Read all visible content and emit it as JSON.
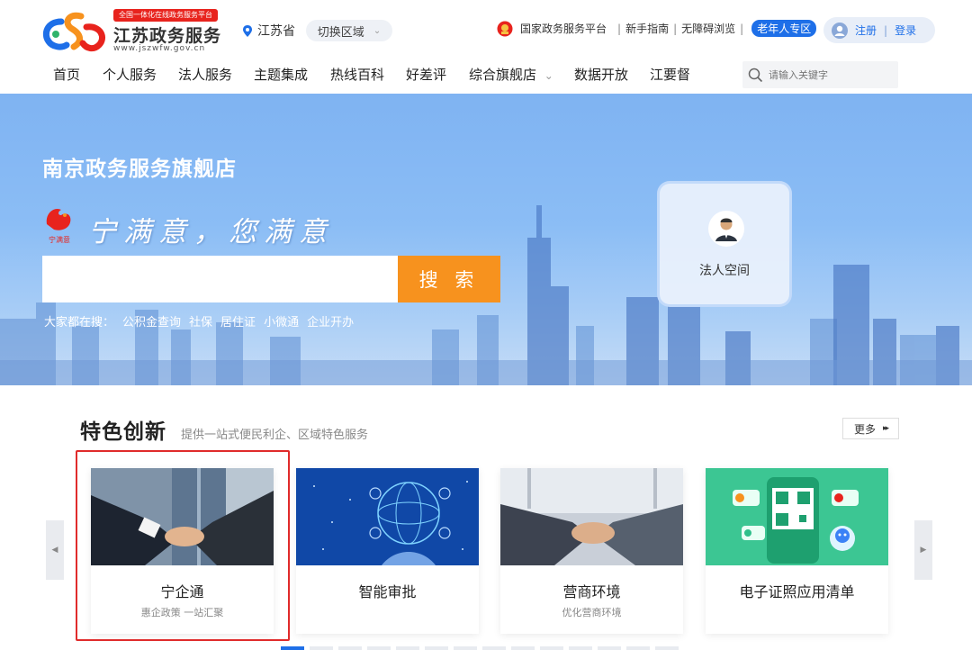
{
  "header": {
    "logo_badge": "全国一体化在线政务服务平台",
    "logo_title": "江苏政务服务",
    "logo_url": "www.jszwfw.gov.cn",
    "region": "江苏省",
    "switch_region": "切换区域",
    "links": [
      "国家政务服务平台",
      "新手指南",
      "无障碍浏览"
    ],
    "elder_zone": "老年人专区",
    "register": "注册",
    "login_sep": "|",
    "login": "登录"
  },
  "nav": {
    "items": [
      "首页",
      "个人服务",
      "法人服务",
      "主题集成",
      "热线百科",
      "好差评",
      "综合旗舰店",
      "数据开放",
      "江要督"
    ],
    "search_placeholder": "请输入关键字"
  },
  "banner": {
    "title": "南京政务服务旗舰店",
    "slogan": "宁满意，您满意",
    "slogan_logo_text": "宁满意",
    "search_button": "搜 索",
    "hot_label": "大家都在搜：",
    "hot_terms": [
      "公积金查询",
      "社保",
      "居住证",
      "小微通",
      "企业开办"
    ],
    "legal_space": "法人空间"
  },
  "featured": {
    "title": "特色创新",
    "subtitle": "提供一站式便民利企、区域特色服务",
    "more": "更多",
    "cards": [
      {
        "title": "宁企通",
        "subtitle": "惠企政策 一站汇聚"
      },
      {
        "title": "智能审批",
        "subtitle": ""
      },
      {
        "title": "营商环境",
        "subtitle": "优化营商环境"
      },
      {
        "title": "电子证照应用清单",
        "subtitle": ""
      }
    ]
  },
  "colors": {
    "accent_blue": "#1e6fe8",
    "search_orange": "#f7921e",
    "highlight_red": "#e02b2b",
    "badge_red": "#e8231d"
  }
}
